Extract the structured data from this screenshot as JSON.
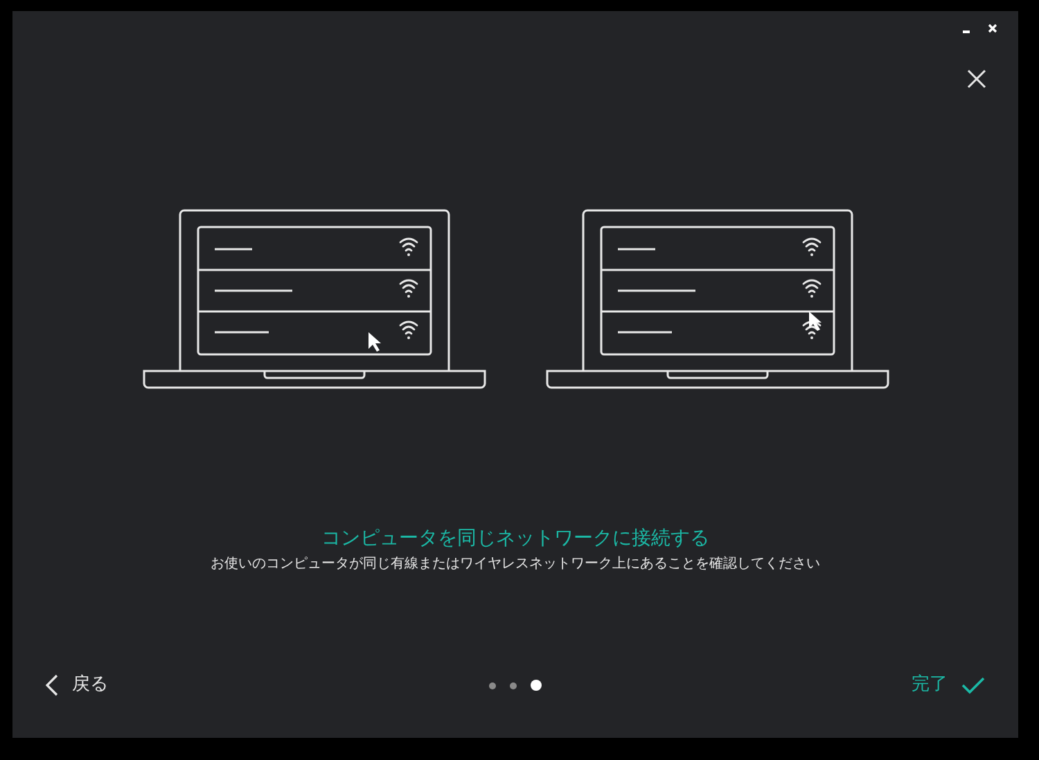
{
  "title": "コンピュータを同じネットワークに接続する",
  "subtitle": "お使いのコンピュータが同じ有線またはワイヤレスネットワーク上にあることを確認してください",
  "back": {
    "label": "戻る"
  },
  "pager": [
    {
      "selected": false
    },
    {
      "selected": false
    },
    {
      "selected": true
    }
  ],
  "done": {
    "label": "完了"
  }
}
